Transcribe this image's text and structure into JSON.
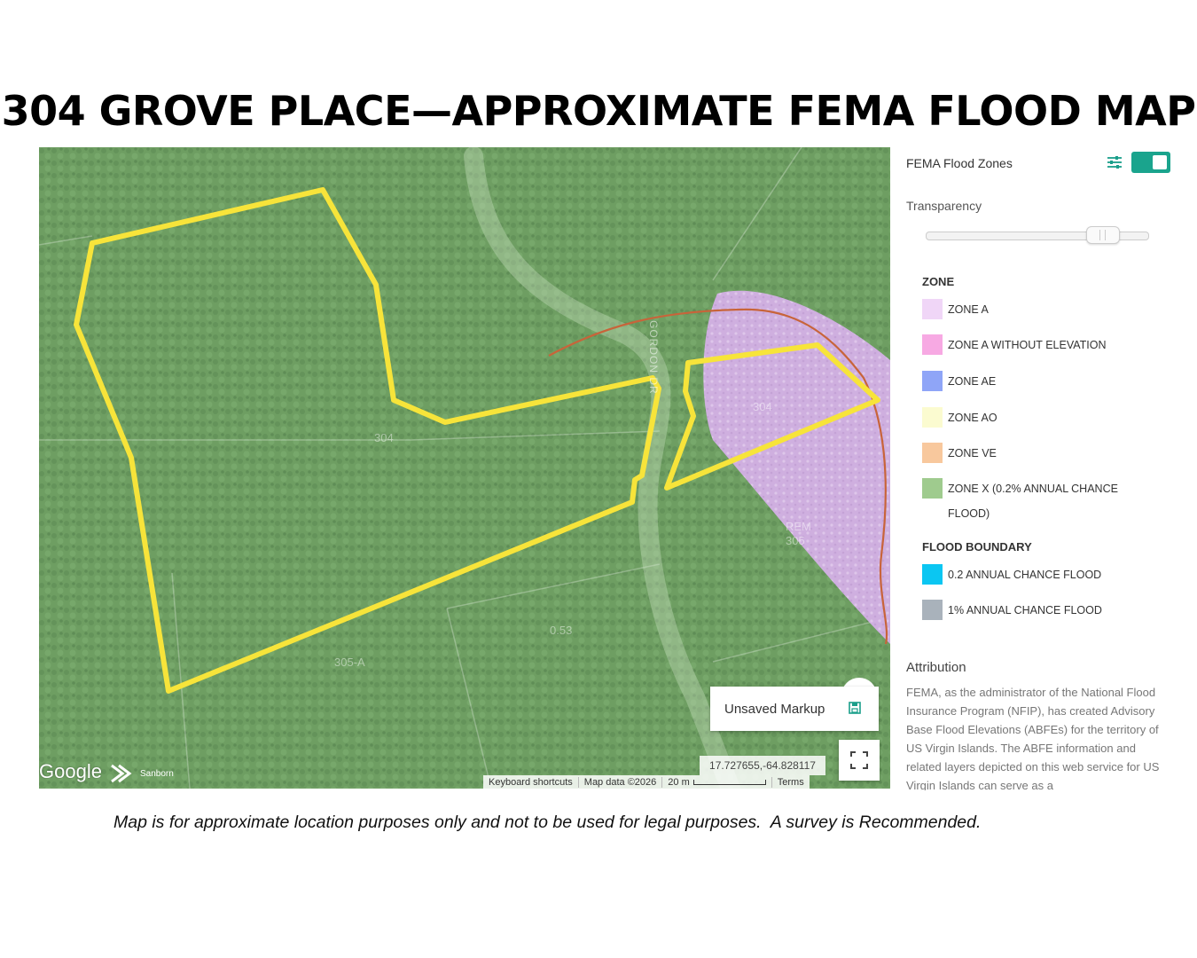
{
  "title": "304 GROVE PLACE—APPROXIMATE FEMA FLOOD MAP",
  "map": {
    "parcel_labels": [
      "304",
      "304",
      "REM 305",
      "0.53",
      "305-A"
    ],
    "road_label": "GORDON DR",
    "google_logo": "Google",
    "sanborn_logo": "Sanborn",
    "unsaved_markup": "Unsaved Markup",
    "coordinates": "17.727655,-64.828117",
    "attribution": {
      "keyboard": "Keyboard shortcuts",
      "map_data": "Map data ©2026",
      "scale": "20 m",
      "terms": "Terms"
    },
    "colors": {
      "parcel_outline": "#f7e43a",
      "zone_a_overlay": "#d7b2ea",
      "flood_line": "#c8643a",
      "base_green": "#6e9e62"
    }
  },
  "panel": {
    "layer_title": "FEMA Flood Zones",
    "layer_enabled": true,
    "transparency_label": "Transparency",
    "transparency_value": 0.82,
    "zone_heading": "ZONE",
    "zones": [
      {
        "label": "ZONE A",
        "color": "#f0d6f7"
      },
      {
        "label": "ZONE A WITHOUT ELEVATION",
        "color": "#f7a9e3"
      },
      {
        "label": "ZONE AE",
        "color": "#8fa5f7"
      },
      {
        "label": "ZONE AO",
        "color": "#fbfbd0"
      },
      {
        "label": "ZONE VE",
        "color": "#f8c89d"
      },
      {
        "label": "ZONE X (0.2% ANNUAL CHANCE FLOOD)",
        "color": "#9fcb8e"
      }
    ],
    "boundary_heading": "FLOOD BOUNDARY",
    "boundaries": [
      {
        "label": "0.2 ANNUAL CHANCE FLOOD",
        "color": "#0bc6f2"
      },
      {
        "label": "1% ANNUAL CHANCE FLOOD",
        "color": "#a9b2bb"
      }
    ],
    "attribution_title": "Attribution",
    "attribution_text": "FEMA, as the administrator of the National Flood Insurance Program (NFIP), has created Advisory Base Flood Elevations (ABFEs) for the territory of US Virgin Islands. The ABFE information and related layers depicted on this web service for US Virgin Islands can serve as a"
  },
  "disclaimer": "Map is for approximate location purposes only and not to be used for legal purposes.  A survey is Recommended."
}
